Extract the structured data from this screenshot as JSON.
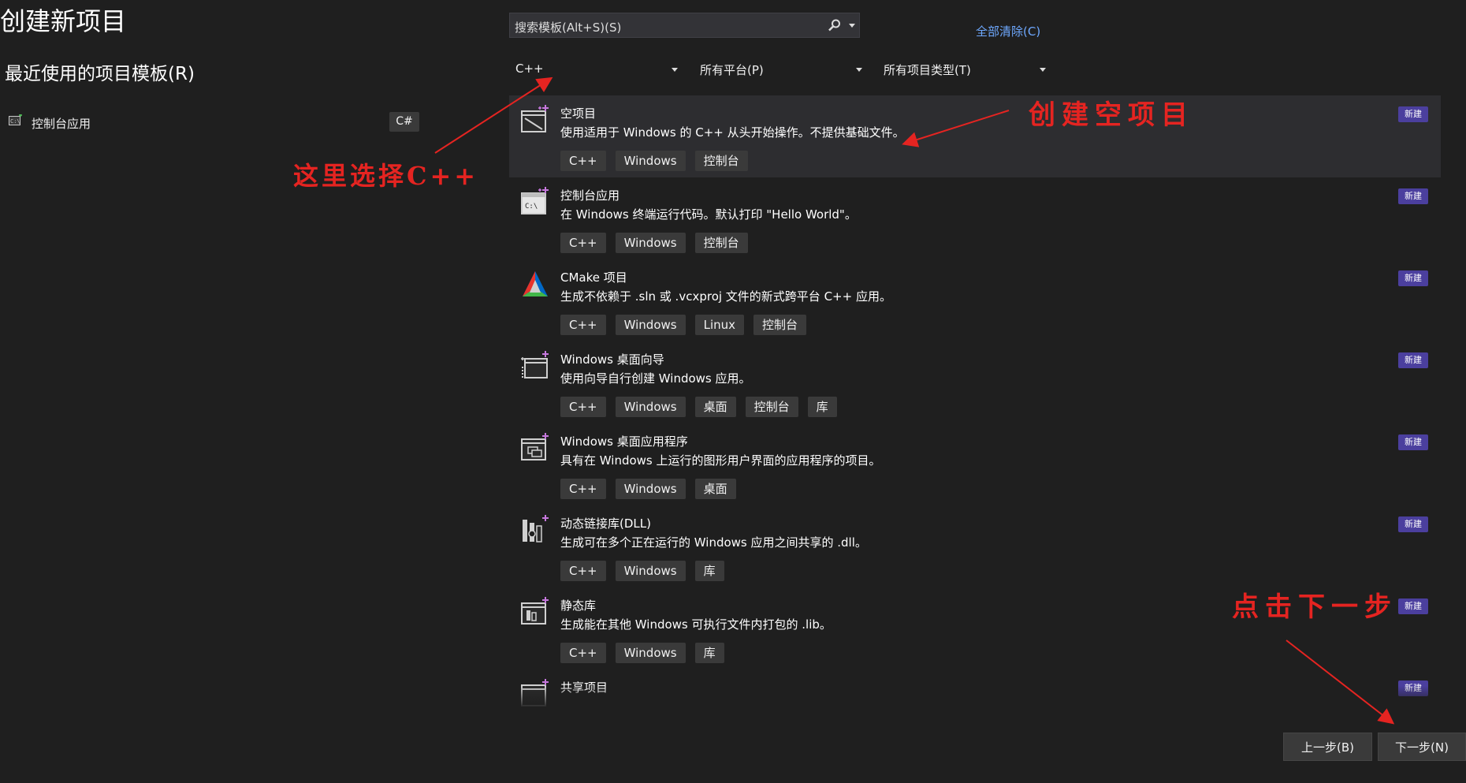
{
  "page": {
    "title": "创建新项目"
  },
  "recent": {
    "title": "最近使用的项目模板(R)",
    "items": [
      {
        "label": "控制台应用",
        "language": "C#",
        "icon": "console-app-icon"
      }
    ]
  },
  "search": {
    "placeholder": "搜索模板(Alt+S)(S)",
    "icon": "search-icon"
  },
  "clear_all": "全部清除(C)",
  "filters": {
    "language": "C++",
    "platform": "所有平台(P)",
    "project_type": "所有项目类型(T)"
  },
  "badge_new": "新建",
  "templates": [
    {
      "name": "空项目",
      "desc": "使用适用于 Windows 的 C++ 从头开始操作。不提供基础文件。",
      "tags": [
        "C++",
        "Windows",
        "控制台"
      ],
      "icon": "empty-project-icon"
    },
    {
      "name": "控制台应用",
      "desc": "在 Windows 终端运行代码。默认打印 \"Hello World\"。",
      "tags": [
        "C++",
        "Windows",
        "控制台"
      ],
      "icon": "console-app-icon"
    },
    {
      "name": "CMake 项目",
      "desc": "生成不依赖于 .sln 或 .vcxproj 文件的新式跨平台 C++ 应用。",
      "tags": [
        "C++",
        "Windows",
        "Linux",
        "控制台"
      ],
      "icon": "cmake-icon"
    },
    {
      "name": "Windows 桌面向导",
      "desc": "使用向导自行创建 Windows 应用。",
      "tags": [
        "C++",
        "Windows",
        "桌面",
        "控制台",
        "库"
      ],
      "icon": "desktop-wizard-icon"
    },
    {
      "name": "Windows 桌面应用程序",
      "desc": "具有在 Windows 上运行的图形用户界面的应用程序的项目。",
      "tags": [
        "C++",
        "Windows",
        "桌面"
      ],
      "icon": "desktop-app-icon"
    },
    {
      "name": "动态链接库(DLL)",
      "desc": "生成可在多个正在运行的 Windows 应用之间共享的 .dll。",
      "tags": [
        "C++",
        "Windows",
        "库"
      ],
      "icon": "dll-icon"
    },
    {
      "name": "静态库",
      "desc": "生成能在其他 Windows 可执行文件内打包的 .lib。",
      "tags": [
        "C++",
        "Windows",
        "库"
      ],
      "icon": "static-lib-icon"
    },
    {
      "name": "共享项目",
      "icon": "shared-project-icon"
    }
  ],
  "buttons": {
    "back": "上一步(B)",
    "next": "下一步(N)"
  },
  "annotations": {
    "choose_cpp": "这里选择C++",
    "create_empty": "创建空项目",
    "click_next": "点击下一步",
    "color": "#e52421"
  },
  "colors": {
    "background": "#1f1f1f",
    "selected_row": "#2d2d30",
    "badge_new": "#4b3f9e",
    "link": "#6ea8fe"
  }
}
